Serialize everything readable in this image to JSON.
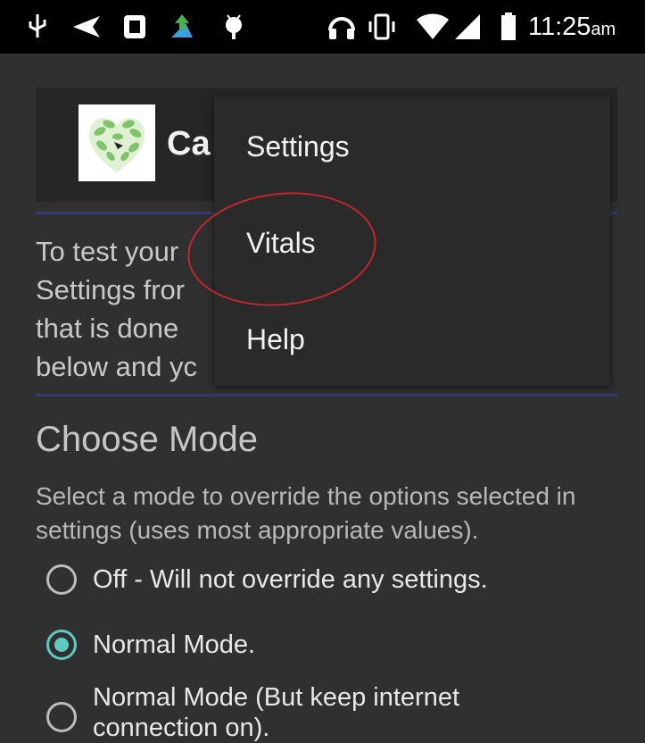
{
  "status_bar": {
    "time": "11:25",
    "ampm": "am",
    "icons": [
      "usb-icon",
      "send-icon",
      "screen-icon",
      "upload-icon",
      "android-icon",
      "headset-icon",
      "vibrate-icon",
      "wifi-icon",
      "signal-icon",
      "battery-icon"
    ]
  },
  "header": {
    "title": "Ca"
  },
  "intro": {
    "lines": [
      "To test your",
      "Settings fror",
      "that is done",
      "below and yc"
    ]
  },
  "mode": {
    "title": "Choose Mode",
    "description": "Select a mode to override the options selected in settings (uses most appropriate values).",
    "options": [
      {
        "label": "Off - Will not override any settings.",
        "checked": false
      },
      {
        "label": "Normal Mode.",
        "checked": true
      },
      {
        "label": "Normal Mode (But keep internet connection on).",
        "checked": false
      }
    ]
  },
  "menu": {
    "items": [
      "Settings",
      "Vitals",
      "Help"
    ]
  },
  "colors": {
    "accent": "#5ec9c0",
    "rule": "#2d3a8c",
    "annotation": "#c0282c"
  }
}
